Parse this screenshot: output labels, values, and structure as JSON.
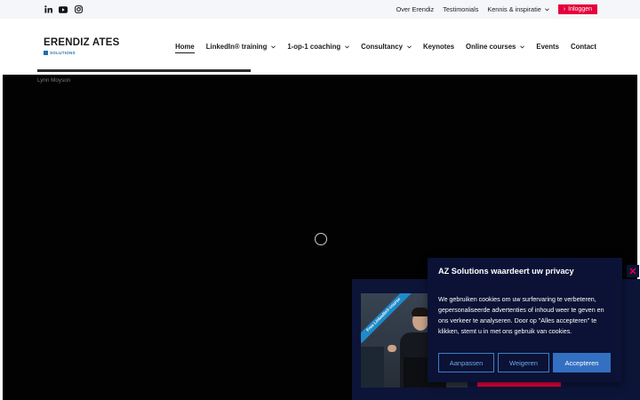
{
  "topbar": {
    "social_icons": [
      "linkedin-icon",
      "youtube-icon",
      "instagram-icon"
    ],
    "links": [
      {
        "label": "Over Erendiz"
      },
      {
        "label": "Testimonials"
      },
      {
        "label": "Kennis & inspiratie",
        "has_dropdown": true
      }
    ],
    "login_label": "Inloggen"
  },
  "logo": {
    "name": "ERENDIZ ATES",
    "sub": "SOLUTIONS"
  },
  "nav": {
    "items": [
      {
        "label": "Home",
        "active": true,
        "has_dropdown": false
      },
      {
        "label": "LinkedIn® training",
        "active": false,
        "has_dropdown": true
      },
      {
        "label": "1-op-1 coaching",
        "active": false,
        "has_dropdown": true
      },
      {
        "label": "Consultancy",
        "active": false,
        "has_dropdown": true
      },
      {
        "label": "Keynotes",
        "active": false,
        "has_dropdown": false
      },
      {
        "label": "Online courses",
        "active": false,
        "has_dropdown": true
      },
      {
        "label": "Events",
        "active": false,
        "has_dropdown": false
      },
      {
        "label": "Contact",
        "active": false,
        "has_dropdown": false
      }
    ]
  },
  "video": {
    "author": "Lynn Moyson"
  },
  "promo": {
    "ribbon_text": "Free LinkedIn® course"
  },
  "cookie": {
    "title": "AZ Solutions waardeert uw privacy",
    "text": "We gebruiken cookies om uw surfervaring te verbeteren, gepersonaliseerde advertenties of inhoud weer te geven en ons verkeer te analyseren. Door op \"Alles accepteren\" te klikken, stemt u in met ons gebruik van cookies.",
    "customize_label": "Aanpassen",
    "reject_label": "Weigeren",
    "accept_label": "Accepteren"
  },
  "colors": {
    "accent_red": "#e4003a",
    "cookie_bg": "#0b1235",
    "cookie_button_blue": "#3470c2",
    "logo_blue": "#1b6fb3"
  }
}
